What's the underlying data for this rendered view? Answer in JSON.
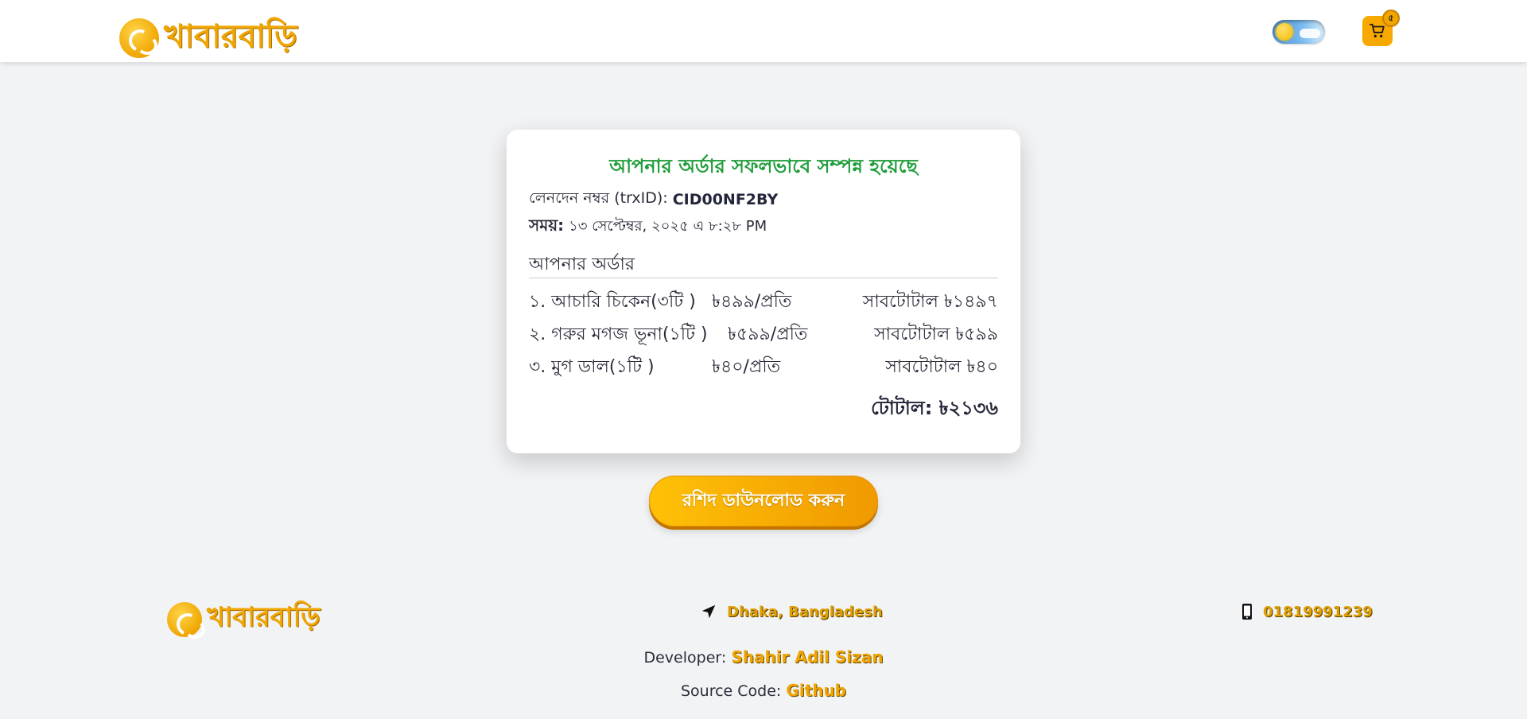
{
  "header": {
    "brand": "খাবারবাড়ি",
    "cart_count": "৫"
  },
  "receipt": {
    "title": "আপনার অর্ডার সফলভাবে সম্পন্ন হয়েছে",
    "trx_label": "লেনদেন নম্বর (trxID):",
    "trx_value": "CID00NF2BY",
    "time_label": "সময়:",
    "time_value": "১৩ সেপ্টেম্বর, ২০২৫ এ ৮:২৮ PM",
    "section_label": "আপনার অর্ডার",
    "items": [
      {
        "name": "১. আচারি চিকেন(৩টি )",
        "price": "৳৪৯৯/প্রতি",
        "subtotal": "সাবটোটাল ৳১৪৯৭"
      },
      {
        "name": "২. গরুর মগজ ভূনা(১টি )",
        "price": "৳৫৯৯/প্রতি",
        "subtotal": "সাবটোটাল ৳৫৯৯"
      },
      {
        "name": "৩. মুগ ডাল(১টি )",
        "price": "৳৪০/প্রতি",
        "subtotal": "সাবটোটাল ৳৪০"
      }
    ],
    "total": "টোটাল: ৳২১৩৬",
    "download_label": "রশিদ ডাউনলোড করুন"
  },
  "footer": {
    "brand": "খাবারবাড়ি",
    "location": "Dhaka, Bangladesh",
    "phone": "01819991239",
    "developer_label": "Developer:",
    "developer_name": "Shahir Adil Sizan",
    "source_label": "Source Code:",
    "source_link": "Github"
  },
  "colors": {
    "accent": "#f0a500",
    "success": "#1f9d3a",
    "background": "#f2f3f5"
  },
  "icons": [
    "logo-icon",
    "sun-icon",
    "cloud-icon",
    "cart-icon",
    "location-arrow-icon",
    "mobile-phone-icon"
  ]
}
